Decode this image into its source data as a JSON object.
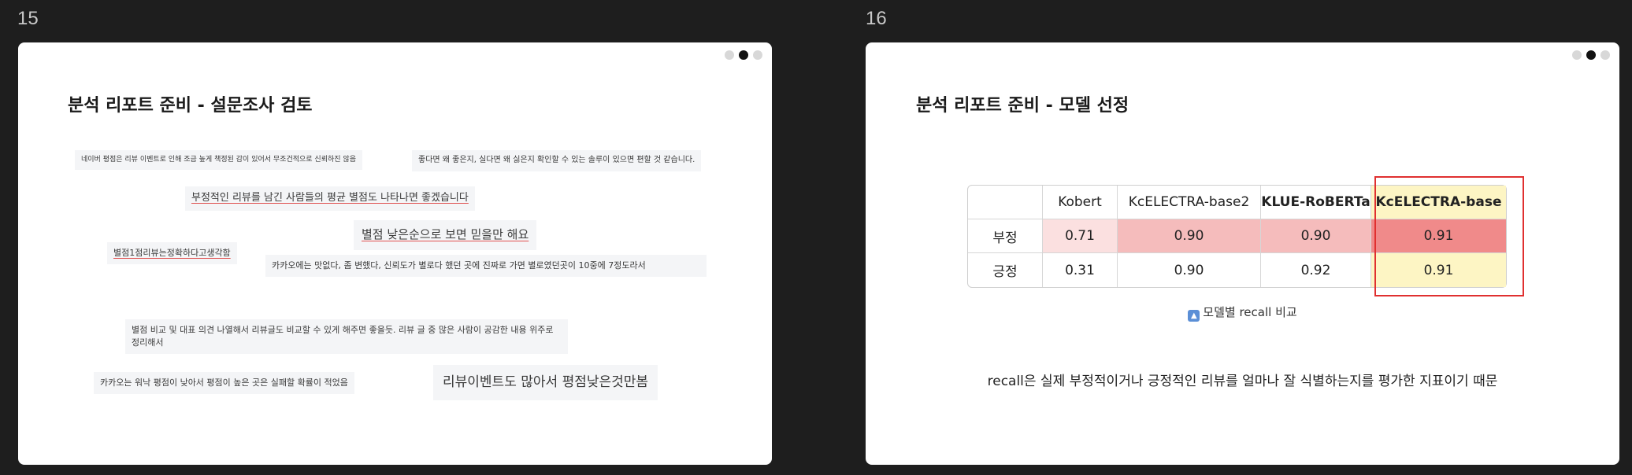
{
  "slides": [
    {
      "number": "15",
      "title": "분석 리포트 준비 - 설문조사 검토",
      "notes": [
        "네이버 평점은 리뷰 이벤트로 인해 조금 높게 책정된 감이 있어서 무조건적으로 신뢰하진 않음",
        "좋다면 왜 좋은지, 실다면 왜 싫은지 확인할 수 있는 솔루이 있으면 편할 것 같습니다.",
        "부정적인 리뷰를 남긴 사람들의 평균 별점도 나타나면 좋겠습니다",
        "별점 낮은순으로 보면 믿을만 해요",
        "별점1점리뷰는정확하다고생각함",
        "카카오에는 맛없다, 좀 변했다, 신뢰도가 별로다 했던 곳에 진짜로 가면 별로였던곳이 10중에 7정도라서",
        "별점 비교 및 대표 의견 나열해서 리뷰글도 비교할 수 있게 해주면 좋을듯. 리뷰 글 중 많은 사람이 공감한 내용 위주로 정리해서",
        "카카오는 워낙 평점이 낮아서 평점이 높은 곳은 실패할 확률이 적었음",
        "리뷰이벤트도 많아서 평점낮은것만봄"
      ]
    },
    {
      "number": "16",
      "title": "분석 리포트 준비 - 모델 선정",
      "table": {
        "headers": [
          "",
          "Kobert",
          "KcELECTRA-base2",
          "KLUE-RoBERTa",
          "KcELECTRA-base"
        ],
        "rows": [
          {
            "label": "부정",
            "values": [
              "0.71",
              "0.90",
              "0.90",
              "0.91"
            ]
          },
          {
            "label": "긍정",
            "values": [
              "0.31",
              "0.90",
              "0.92",
              "0.91"
            ]
          }
        ]
      },
      "caption": "모델별 recall 비교",
      "summary": "recall은 실제 부정적이거나 긍정적인 리뷰를 얼마나 잘 식별하는지를 평가한 지표이기 때문"
    }
  ],
  "colors": {
    "neg_light": "#fbe0e0",
    "neg_mid": "#f5bcbc",
    "neg_strong": "#f08a8a",
    "highlight_yellow": "#fdf5c4",
    "red_box": "#e03030"
  }
}
